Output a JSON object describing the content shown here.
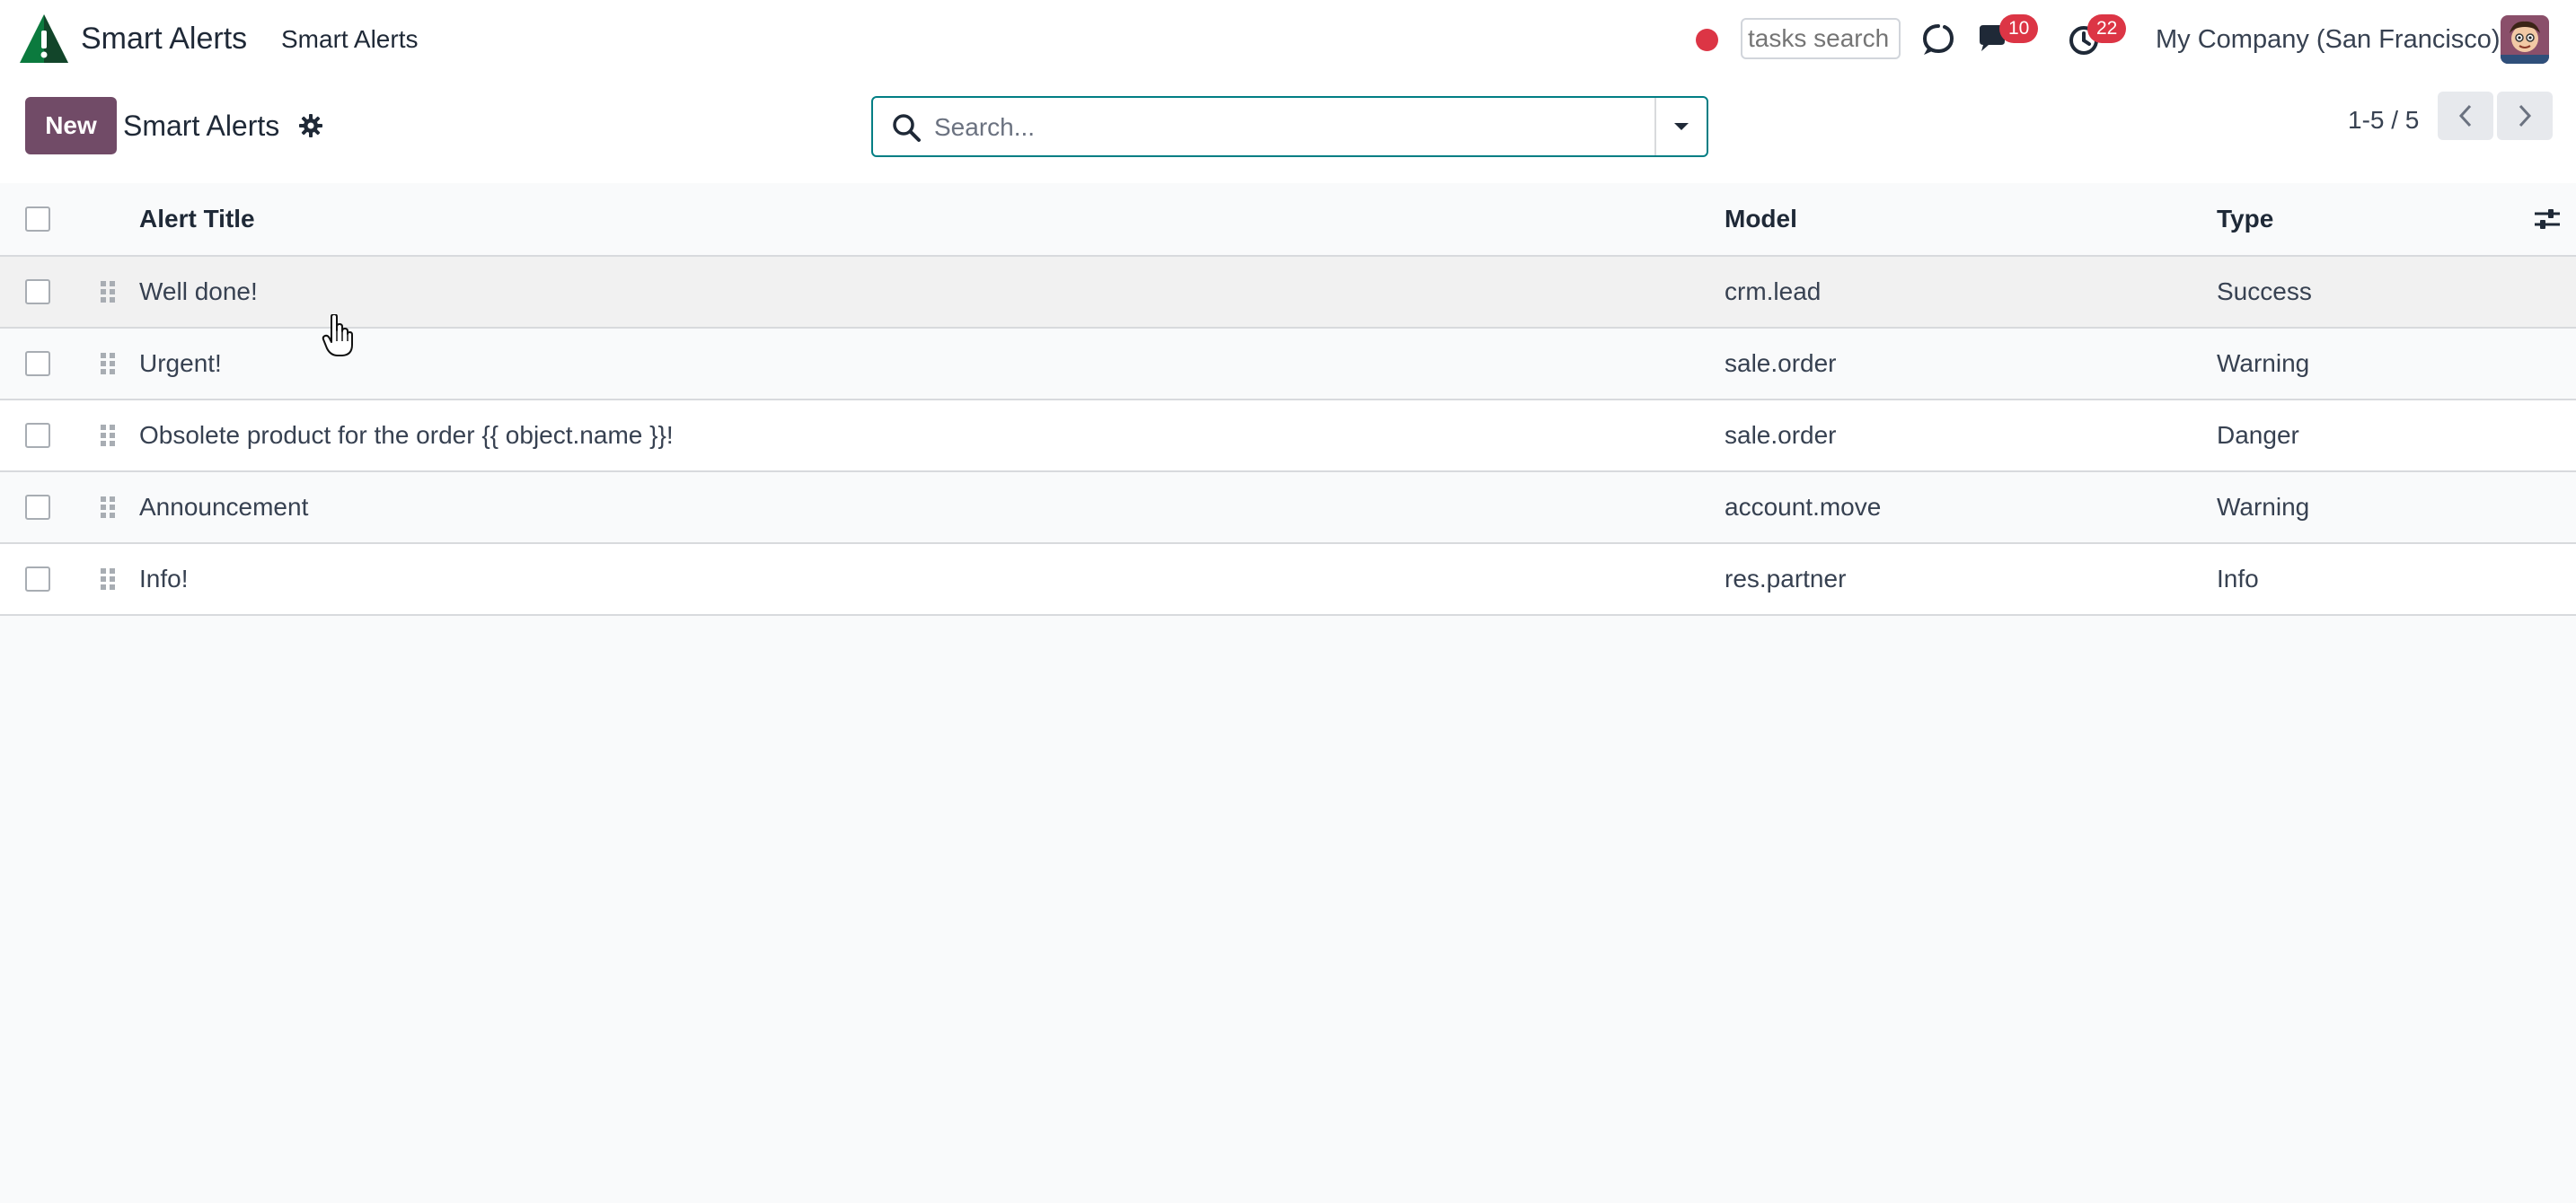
{
  "navbar": {
    "app_name": "Smart Alerts",
    "menu_item": "Smart Alerts",
    "tasks_search_placeholder": "tasks search",
    "messages_badge": "10",
    "activities_badge": "22",
    "company": "My Company (San Francisco)"
  },
  "control_panel": {
    "new_label": "New",
    "title": "Smart Alerts",
    "search_placeholder": "Search...",
    "pager_value": "1-5 / 5"
  },
  "table": {
    "columns": {
      "title": "Alert Title",
      "model": "Model",
      "type": "Type"
    },
    "rows": [
      {
        "title": "Well done!",
        "model": "crm.lead",
        "type": "Success"
      },
      {
        "title": "Urgent!",
        "model": "sale.order",
        "type": "Warning"
      },
      {
        "title": "Obsolete product for the order {{ object.name }}!",
        "model": "sale.order",
        "type": "Danger"
      },
      {
        "title": "Announcement",
        "model": "account.move",
        "type": "Warning"
      },
      {
        "title": "Info!",
        "model": "res.partner",
        "type": "Info"
      }
    ]
  },
  "colors": {
    "brand": "#714b67",
    "search_border": "#017e84",
    "badge": "#dc3545"
  },
  "icons": {
    "logo": "warning-triangle-logo-icon",
    "settings": "gear-icon",
    "search": "search-icon",
    "chat": "chat-icon",
    "activity": "clock-icon",
    "discuss": "discuss-icon",
    "optional_columns": "sliders-icon",
    "drag": "drag-handle-icon"
  }
}
